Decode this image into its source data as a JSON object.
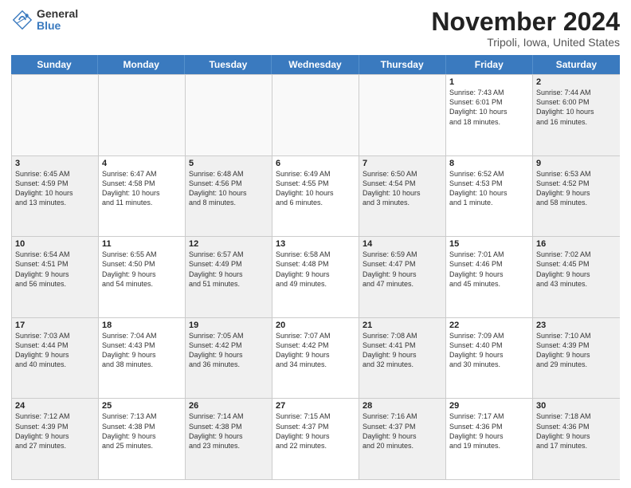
{
  "logo": {
    "general": "General",
    "blue": "Blue"
  },
  "title": "November 2024",
  "location": "Tripoli, Iowa, United States",
  "days_of_week": [
    "Sunday",
    "Monday",
    "Tuesday",
    "Wednesday",
    "Thursday",
    "Friday",
    "Saturday"
  ],
  "weeks": [
    [
      {
        "day": "",
        "info": ""
      },
      {
        "day": "",
        "info": ""
      },
      {
        "day": "",
        "info": ""
      },
      {
        "day": "",
        "info": ""
      },
      {
        "day": "",
        "info": ""
      },
      {
        "day": "1",
        "info": "Sunrise: 7:43 AM\nSunset: 6:01 PM\nDaylight: 10 hours\nand 18 minutes."
      },
      {
        "day": "2",
        "info": "Sunrise: 7:44 AM\nSunset: 6:00 PM\nDaylight: 10 hours\nand 16 minutes."
      }
    ],
    [
      {
        "day": "3",
        "info": "Sunrise: 6:45 AM\nSunset: 4:59 PM\nDaylight: 10 hours\nand 13 minutes."
      },
      {
        "day": "4",
        "info": "Sunrise: 6:47 AM\nSunset: 4:58 PM\nDaylight: 10 hours\nand 11 minutes."
      },
      {
        "day": "5",
        "info": "Sunrise: 6:48 AM\nSunset: 4:56 PM\nDaylight: 10 hours\nand 8 minutes."
      },
      {
        "day": "6",
        "info": "Sunrise: 6:49 AM\nSunset: 4:55 PM\nDaylight: 10 hours\nand 6 minutes."
      },
      {
        "day": "7",
        "info": "Sunrise: 6:50 AM\nSunset: 4:54 PM\nDaylight: 10 hours\nand 3 minutes."
      },
      {
        "day": "8",
        "info": "Sunrise: 6:52 AM\nSunset: 4:53 PM\nDaylight: 10 hours\nand 1 minute."
      },
      {
        "day": "9",
        "info": "Sunrise: 6:53 AM\nSunset: 4:52 PM\nDaylight: 9 hours\nand 58 minutes."
      }
    ],
    [
      {
        "day": "10",
        "info": "Sunrise: 6:54 AM\nSunset: 4:51 PM\nDaylight: 9 hours\nand 56 minutes."
      },
      {
        "day": "11",
        "info": "Sunrise: 6:55 AM\nSunset: 4:50 PM\nDaylight: 9 hours\nand 54 minutes."
      },
      {
        "day": "12",
        "info": "Sunrise: 6:57 AM\nSunset: 4:49 PM\nDaylight: 9 hours\nand 51 minutes."
      },
      {
        "day": "13",
        "info": "Sunrise: 6:58 AM\nSunset: 4:48 PM\nDaylight: 9 hours\nand 49 minutes."
      },
      {
        "day": "14",
        "info": "Sunrise: 6:59 AM\nSunset: 4:47 PM\nDaylight: 9 hours\nand 47 minutes."
      },
      {
        "day": "15",
        "info": "Sunrise: 7:01 AM\nSunset: 4:46 PM\nDaylight: 9 hours\nand 45 minutes."
      },
      {
        "day": "16",
        "info": "Sunrise: 7:02 AM\nSunset: 4:45 PM\nDaylight: 9 hours\nand 43 minutes."
      }
    ],
    [
      {
        "day": "17",
        "info": "Sunrise: 7:03 AM\nSunset: 4:44 PM\nDaylight: 9 hours\nand 40 minutes."
      },
      {
        "day": "18",
        "info": "Sunrise: 7:04 AM\nSunset: 4:43 PM\nDaylight: 9 hours\nand 38 minutes."
      },
      {
        "day": "19",
        "info": "Sunrise: 7:05 AM\nSunset: 4:42 PM\nDaylight: 9 hours\nand 36 minutes."
      },
      {
        "day": "20",
        "info": "Sunrise: 7:07 AM\nSunset: 4:42 PM\nDaylight: 9 hours\nand 34 minutes."
      },
      {
        "day": "21",
        "info": "Sunrise: 7:08 AM\nSunset: 4:41 PM\nDaylight: 9 hours\nand 32 minutes."
      },
      {
        "day": "22",
        "info": "Sunrise: 7:09 AM\nSunset: 4:40 PM\nDaylight: 9 hours\nand 30 minutes."
      },
      {
        "day": "23",
        "info": "Sunrise: 7:10 AM\nSunset: 4:39 PM\nDaylight: 9 hours\nand 29 minutes."
      }
    ],
    [
      {
        "day": "24",
        "info": "Sunrise: 7:12 AM\nSunset: 4:39 PM\nDaylight: 9 hours\nand 27 minutes."
      },
      {
        "day": "25",
        "info": "Sunrise: 7:13 AM\nSunset: 4:38 PM\nDaylight: 9 hours\nand 25 minutes."
      },
      {
        "day": "26",
        "info": "Sunrise: 7:14 AM\nSunset: 4:38 PM\nDaylight: 9 hours\nand 23 minutes."
      },
      {
        "day": "27",
        "info": "Sunrise: 7:15 AM\nSunset: 4:37 PM\nDaylight: 9 hours\nand 22 minutes."
      },
      {
        "day": "28",
        "info": "Sunrise: 7:16 AM\nSunset: 4:37 PM\nDaylight: 9 hours\nand 20 minutes."
      },
      {
        "day": "29",
        "info": "Sunrise: 7:17 AM\nSunset: 4:36 PM\nDaylight: 9 hours\nand 19 minutes."
      },
      {
        "day": "30",
        "info": "Sunrise: 7:18 AM\nSunset: 4:36 PM\nDaylight: 9 hours\nand 17 minutes."
      }
    ]
  ]
}
